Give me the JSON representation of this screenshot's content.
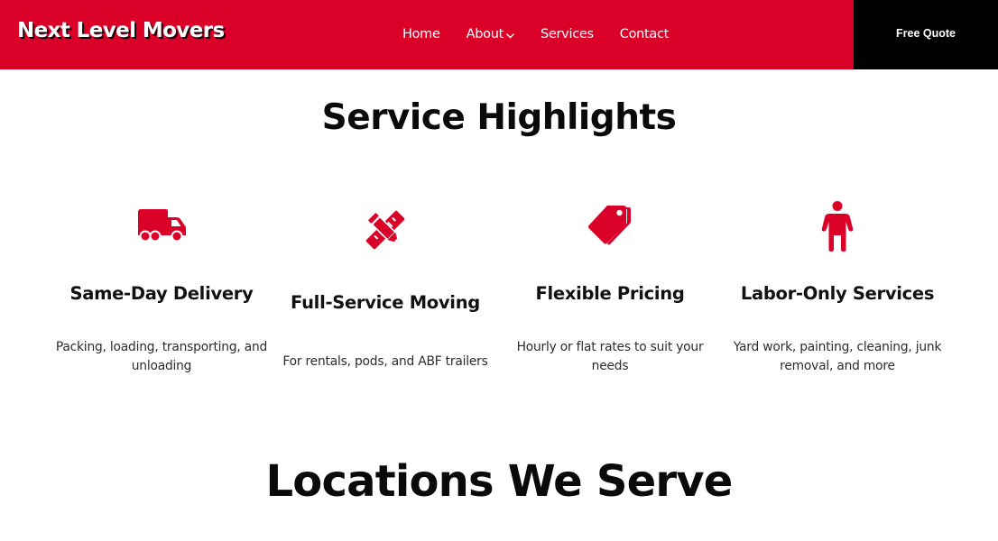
{
  "header": {
    "logo": "Next Level Movers",
    "nav": [
      {
        "label": "Home"
      },
      {
        "label": "About",
        "has_dropdown": true
      },
      {
        "label": "Services"
      },
      {
        "label": "Contact"
      }
    ],
    "cta_label": "Free Quote",
    "brand_color": "#db0028",
    "cta_bg": "#000000"
  },
  "highlights": {
    "title": "Service Highlights",
    "icon_color": "#db0028",
    "items": [
      {
        "icon": "truck-icon",
        "title": "Same-Day Delivery",
        "description": "Packing, loading, transporting, and unloading"
      },
      {
        "icon": "pencil-ruler-icon",
        "title": "Full-Service Moving",
        "description": "For rentals, pods, and ABF trailers"
      },
      {
        "icon": "tags-icon",
        "title": "Flexible Pricing",
        "description": "Hourly or flat rates to suit your needs"
      },
      {
        "icon": "person-icon",
        "title": "Labor-Only Services",
        "description": "Yard work, painting, cleaning, junk removal, and more"
      }
    ]
  },
  "locations": {
    "title": "Locations We Serve"
  }
}
